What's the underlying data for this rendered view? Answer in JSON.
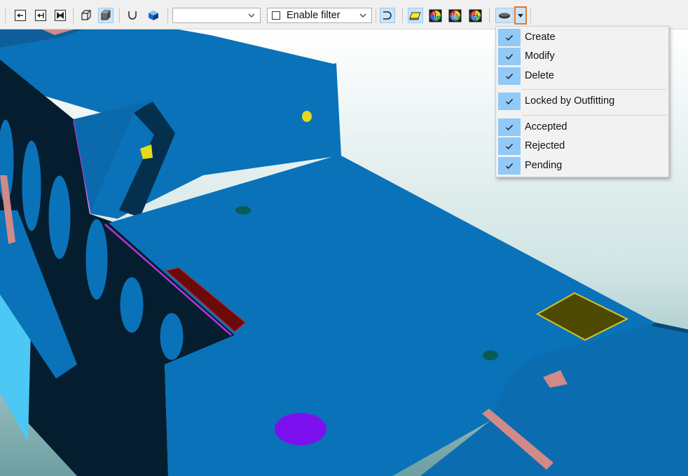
{
  "toolbar": {
    "display_dropdown": {
      "selected": ""
    },
    "filter": {
      "label": "Enable filter",
      "checked": false
    },
    "tools": [
      {
        "name": "move-left-icon"
      },
      {
        "name": "move-right-icon"
      },
      {
        "name": "fit-icon"
      },
      {
        "name": "wireframe-box-icon"
      },
      {
        "name": "shaded-box-icon",
        "active": true
      },
      {
        "name": "curve-icon"
      },
      {
        "name": "solid-cube-icon"
      },
      {
        "name": "select-curve-icon",
        "active": true
      },
      {
        "name": "plate-icon",
        "active": true
      },
      {
        "name": "color-t-icon",
        "letter": "T"
      },
      {
        "name": "color-m-icon",
        "letter": "M"
      },
      {
        "name": "color-h-icon",
        "letter": "H"
      },
      {
        "name": "status-ellipse-icon",
        "active": true
      },
      {
        "name": "status-dropdown-icon",
        "highlight": "#e07a2e"
      }
    ]
  },
  "status_menu": {
    "items": [
      {
        "label": "Create",
        "checked": true
      },
      {
        "label": "Modify",
        "checked": true
      },
      {
        "label": "Delete",
        "checked": true
      },
      {
        "label": "Locked by Outfitting",
        "checked": true
      },
      {
        "label": "Accepted",
        "checked": true
      },
      {
        "label": "Rejected",
        "checked": true
      },
      {
        "label": "Pending",
        "checked": true
      }
    ]
  },
  "colors": {
    "hull_blue": "#0a72b8",
    "dark_shadow": "#041e30",
    "light_blue": "#4cc8f4",
    "menu_check_bg": "#91c9f7",
    "olive_plate": "#4f4a03",
    "purple_disc": "#7c10ee",
    "red_bar": "#6b0a0a",
    "pink_stiffener": "#d08a88"
  }
}
